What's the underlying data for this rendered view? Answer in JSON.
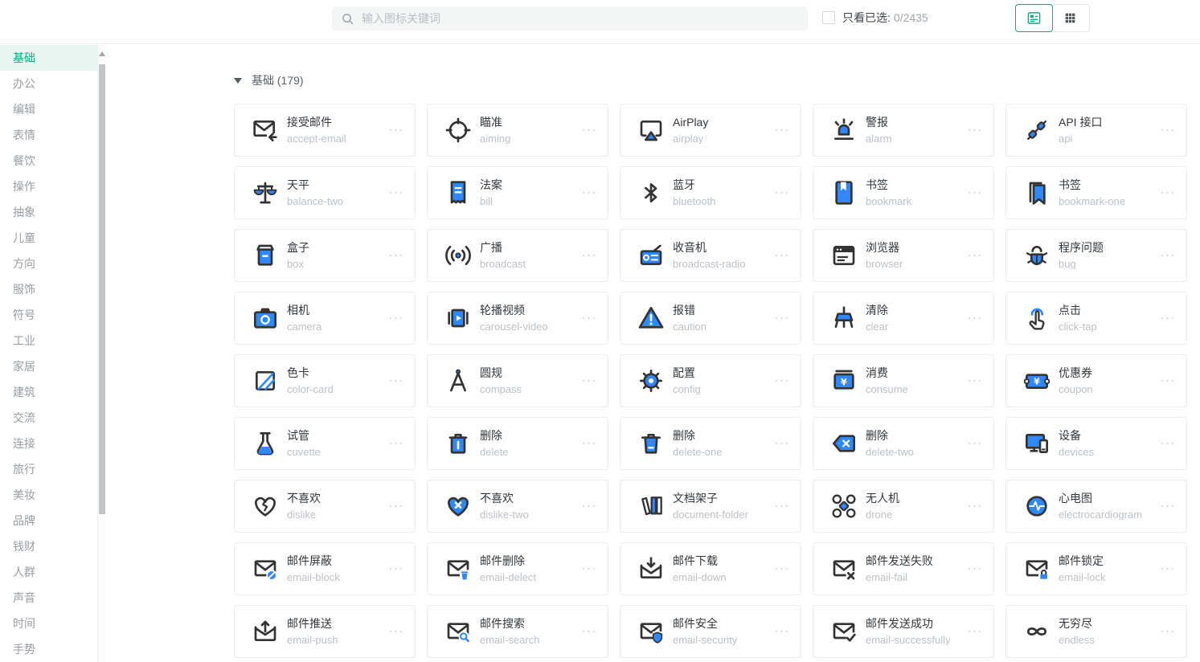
{
  "topbar": {
    "search_placeholder": "输入图标关键词",
    "filter_label": "只看已选:",
    "filter_count": "0/2435",
    "filter_checked": false,
    "view_modes": [
      "detail-view",
      "grid-view"
    ],
    "active_view": "detail-view"
  },
  "sidebar": {
    "active": "基础",
    "items": [
      "基础",
      "办公",
      "编辑",
      "表情",
      "餐饮",
      "操作",
      "抽象",
      "儿童",
      "方向",
      "服饰",
      "符号",
      "工业",
      "家居",
      "建筑",
      "交流",
      "连接",
      "旅行",
      "美妆",
      "品牌",
      "钱财",
      "人群",
      "声音",
      "时间",
      "手势"
    ]
  },
  "content": {
    "section_label": "基础 (179)",
    "section_collapse_icon": "caret-down-icon",
    "icons": [
      {
        "title": "接受邮件",
        "name": "accept-email"
      },
      {
        "title": "瞄准",
        "name": "aiming"
      },
      {
        "title": "AirPlay",
        "name": "airplay"
      },
      {
        "title": "警报",
        "name": "alarm"
      },
      {
        "title": "API 接口",
        "name": "api"
      },
      {
        "title": "天平",
        "name": "balance-two"
      },
      {
        "title": "法案",
        "name": "bill"
      },
      {
        "title": "蓝牙",
        "name": "bluetooth"
      },
      {
        "title": "书签",
        "name": "bookmark"
      },
      {
        "title": "书签",
        "name": "bookmark-one"
      },
      {
        "title": "盒子",
        "name": "box"
      },
      {
        "title": "广播",
        "name": "broadcast"
      },
      {
        "title": "收音机",
        "name": "broadcast-radio"
      },
      {
        "title": "浏览器",
        "name": "browser"
      },
      {
        "title": "程序问题",
        "name": "bug"
      },
      {
        "title": "相机",
        "name": "camera"
      },
      {
        "title": "轮播视频",
        "name": "carousel-video"
      },
      {
        "title": "报错",
        "name": "caution"
      },
      {
        "title": "清除",
        "name": "clear"
      },
      {
        "title": "点击",
        "name": "click-tap"
      },
      {
        "title": "色卡",
        "name": "color-card"
      },
      {
        "title": "圆规",
        "name": "compass"
      },
      {
        "title": "配置",
        "name": "config"
      },
      {
        "title": "消费",
        "name": "consume"
      },
      {
        "title": "优惠券",
        "name": "coupon"
      },
      {
        "title": "试管",
        "name": "cuvette"
      },
      {
        "title": "删除",
        "name": "delete"
      },
      {
        "title": "删除",
        "name": "delete-one"
      },
      {
        "title": "删除",
        "name": "delete-two"
      },
      {
        "title": "设备",
        "name": "devices"
      },
      {
        "title": "不喜欢",
        "name": "dislike"
      },
      {
        "title": "不喜欢",
        "name": "dislike-two"
      },
      {
        "title": "文档架子",
        "name": "document-folder"
      },
      {
        "title": "无人机",
        "name": "drone"
      },
      {
        "title": "心电图",
        "name": "electrocardiogram"
      },
      {
        "title": "邮件屏蔽",
        "name": "email-block"
      },
      {
        "title": "邮件删除",
        "name": "email-delect"
      },
      {
        "title": "邮件下载",
        "name": "email-down"
      },
      {
        "title": "邮件发送失败",
        "name": "email-fail"
      },
      {
        "title": "邮件锁定",
        "name": "email-lock"
      },
      {
        "title": "邮件推送",
        "name": "email-push"
      },
      {
        "title": "邮件搜索",
        "name": "email-search"
      },
      {
        "title": "邮件安全",
        "name": "email-security"
      },
      {
        "title": "邮件发送成功",
        "name": "email-successfully"
      },
      {
        "title": "无穷尽",
        "name": "endless"
      }
    ],
    "card_more_label": "···"
  },
  "colors": {
    "accent_teal": "#12a98a",
    "sidebar_active_bg": "#e8f6f1",
    "icon_blue": "#2F88FF",
    "icon_dark": "#333333"
  }
}
